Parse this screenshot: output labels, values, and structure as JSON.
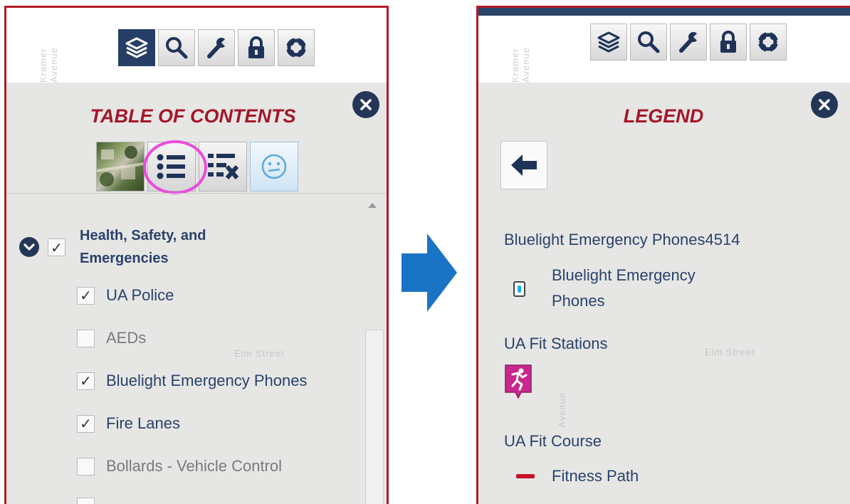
{
  "toolbar": {
    "buttons": [
      {
        "icon": "layers-icon",
        "active_in_left": true
      },
      {
        "icon": "search-icon"
      },
      {
        "icon": "wrench-icon"
      },
      {
        "icon": "lock-icon"
      },
      {
        "icon": "lifebuoy-icon"
      }
    ]
  },
  "map_labels": {
    "kramer": "Kramer Avenue",
    "elm": "Elm Street",
    "cross": "Avenue"
  },
  "left": {
    "title": "TABLE OF CONTENTS",
    "tabs": [
      "basemap-thumbnail",
      "legend-list-icon",
      "remove-layers-icon",
      "smiley-icon"
    ],
    "group": {
      "label": "Health, Safety, and Emergencies",
      "checked": true,
      "expanded": true
    },
    "layers": [
      {
        "label": "UA Police",
        "checked": true,
        "mark": "✓"
      },
      {
        "label": "AEDs",
        "checked": false,
        "mark": ""
      },
      {
        "label": "Bluelight Emergency Phones",
        "checked": true,
        "mark": "✓"
      },
      {
        "label": "Fire Lanes",
        "checked": true,
        "mark": "✓"
      },
      {
        "label": "Bollards - Vehicle Control",
        "checked": false,
        "mark": ""
      }
    ]
  },
  "right": {
    "title": "LEGEND",
    "sections": [
      {
        "heading": "Bluelight Emergency Phones4514",
        "item": "Bluelight Emergency Phones"
      },
      {
        "heading": "UA Fit Stations",
        "item": ""
      },
      {
        "heading": "UA Fit Course",
        "item": "Fitness Path"
      }
    ]
  },
  "colors": {
    "navy": "#243658",
    "title_red": "#a3172a",
    "frame_red": "#b31b2a",
    "link_blue": "#2a426b",
    "highlight_pink": "#ea4bdc",
    "arrow_blue": "#1b73c6",
    "fit_magenta": "#c8288e",
    "path_red": "#c61328"
  }
}
